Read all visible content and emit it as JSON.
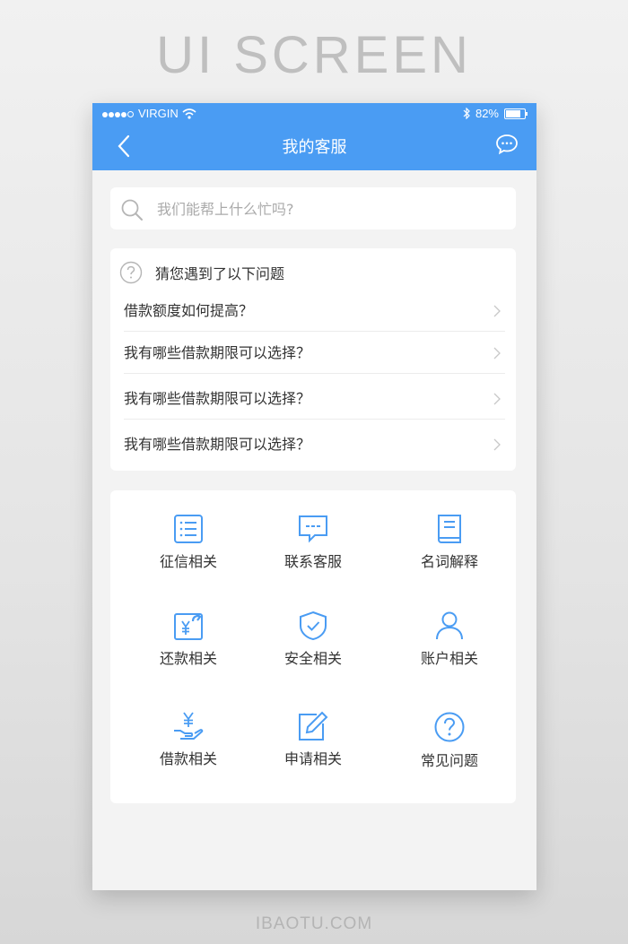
{
  "poster": {
    "headline": "UI SCREEN",
    "footer": "IBAOTU.COM"
  },
  "status_bar": {
    "carrier": "VIRGIN",
    "battery": "82%"
  },
  "nav": {
    "title": "我的客服"
  },
  "search": {
    "placeholder": "我们能帮上什么忙吗?"
  },
  "faq": {
    "heading": "猜您遇到了以下问题",
    "items": [
      "借款额度如何提高？",
      "我有哪些借款期限可以选择？",
      "我有哪些借款期限可以选择？",
      "我有哪些借款期限可以选择？"
    ]
  },
  "categories": [
    {
      "label": "征信相关",
      "icon": "list-icon"
    },
    {
      "label": "联系客服",
      "icon": "chat-bubble-icon"
    },
    {
      "label": "名词解释",
      "icon": "book-icon"
    },
    {
      "label": "还款相关",
      "icon": "yen-return-icon"
    },
    {
      "label": "安全相关",
      "icon": "shield-icon"
    },
    {
      "label": "账户相关",
      "icon": "user-icon"
    },
    {
      "label": "借款相关",
      "icon": "yen-hand-icon"
    },
    {
      "label": "申请相关",
      "icon": "edit-icon"
    },
    {
      "label": "常见问题",
      "icon": "question-icon"
    }
  ],
  "colors": {
    "accent": "#4a9cf3"
  }
}
